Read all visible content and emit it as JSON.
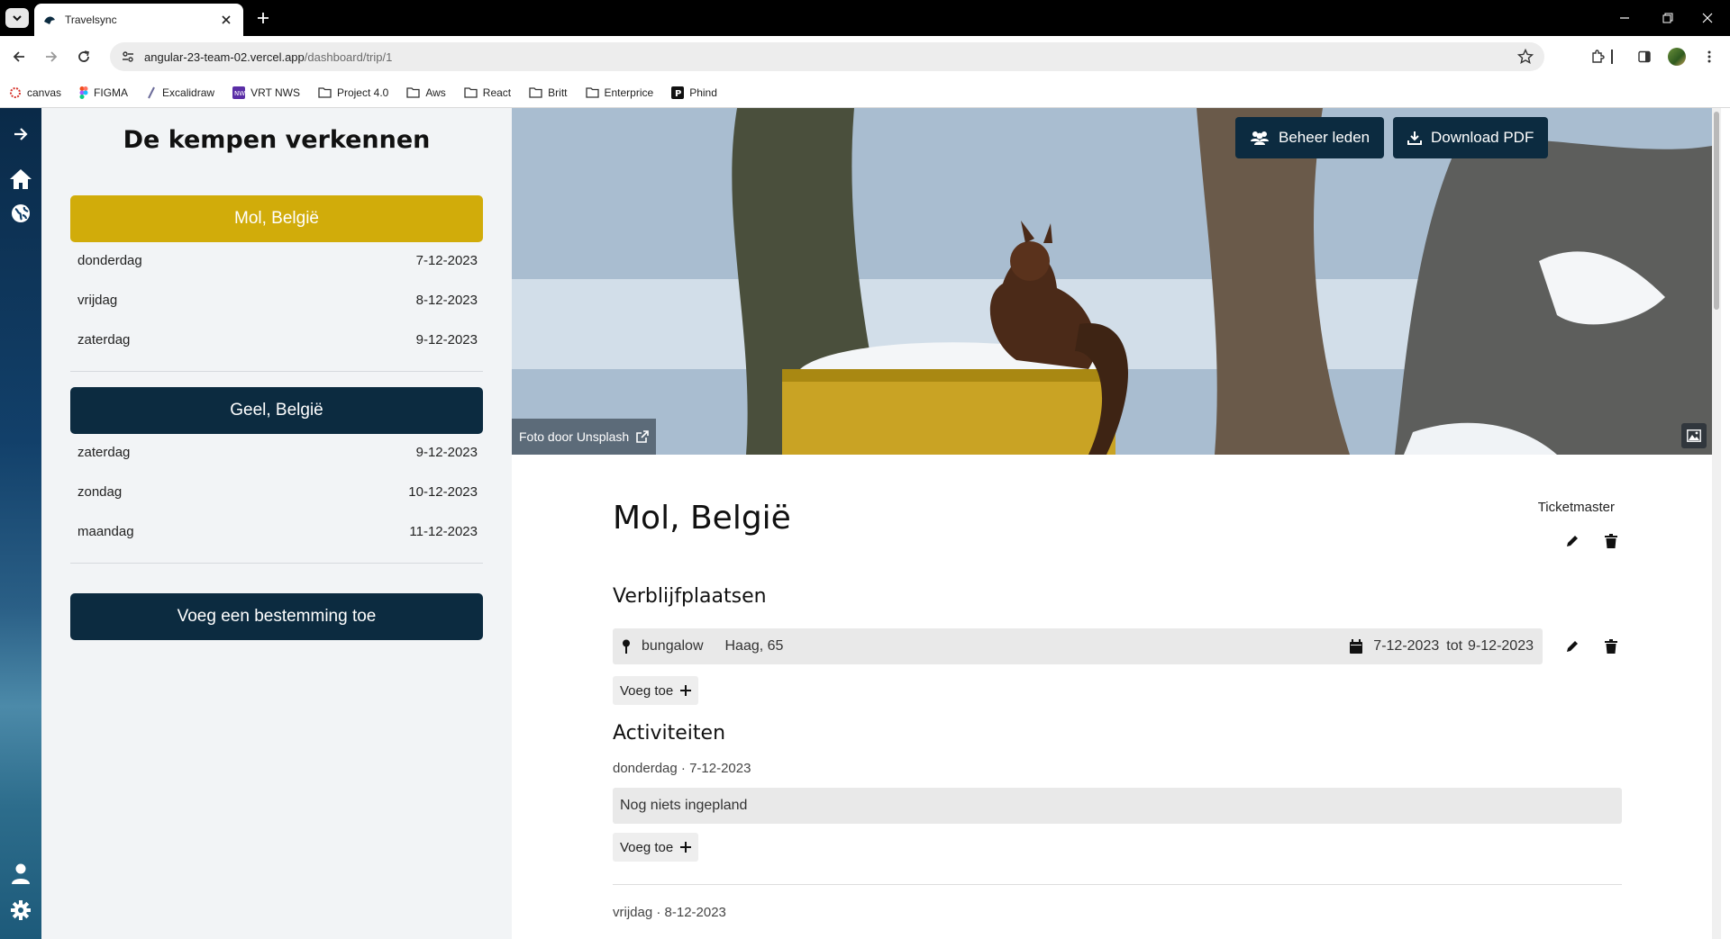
{
  "browser": {
    "tab_title": "Travelsync",
    "url_host": "angular-23-team-02.vercel.app",
    "url_path": "/dashboard/trip/1",
    "bookmarks": [
      {
        "label": "canvas",
        "icon": "canvas-icon"
      },
      {
        "label": "FIGMA",
        "icon": "figma-icon"
      },
      {
        "label": "Excalidraw",
        "icon": "excalidraw-icon"
      },
      {
        "label": "VRT NWS",
        "icon": "vrt-icon"
      },
      {
        "label": "Project 4.0",
        "icon": "folder-icon"
      },
      {
        "label": "Aws",
        "icon": "folder-icon"
      },
      {
        "label": "React",
        "icon": "folder-icon"
      },
      {
        "label": "Britt",
        "icon": "folder-icon"
      },
      {
        "label": "Enterprice",
        "icon": "folder-icon"
      },
      {
        "label": "Phind",
        "icon": "phind-icon"
      }
    ]
  },
  "sidebar": {
    "trip_title": "De kempen verkennen",
    "destinations": [
      {
        "name": "Mol, België",
        "days": [
          {
            "day": "donderdag",
            "date": "7-12-2023"
          },
          {
            "day": "vrijdag",
            "date": "8-12-2023"
          },
          {
            "day": "zaterdag",
            "date": "9-12-2023"
          }
        ]
      },
      {
        "name": "Geel, België",
        "days": [
          {
            "day": "zaterdag",
            "date": "9-12-2023"
          },
          {
            "day": "zondag",
            "date": "10-12-2023"
          },
          {
            "day": "maandag",
            "date": "11-12-2023"
          }
        ]
      }
    ],
    "add_destination": "Voeg een bestemming toe"
  },
  "hero": {
    "manage_members": "Beheer leden",
    "download_pdf": "Download PDF",
    "photo_credit": "Foto door Unsplash"
  },
  "main": {
    "title": "Mol, België",
    "ticket_label": "Ticketmaster",
    "stays_heading": "Verblijfplaatsen",
    "stay": {
      "name": "bungalow",
      "address": "Haag, 65",
      "from": "7-12-2023",
      "to_word": "tot",
      "to": "9-12-2023"
    },
    "add_label": "Voeg toe",
    "activities_heading": "Activiteiten",
    "activity_days": [
      {
        "header": "donderdag · 7-12-2023",
        "empty": "Nog niets ingepland"
      },
      {
        "header": "vrijdag · 8-12-2023"
      }
    ]
  },
  "colors": {
    "active_destination": "#d1ac0a",
    "dark_navy": "#0c2b40",
    "sidebar_bg": "#f2f4f6"
  }
}
